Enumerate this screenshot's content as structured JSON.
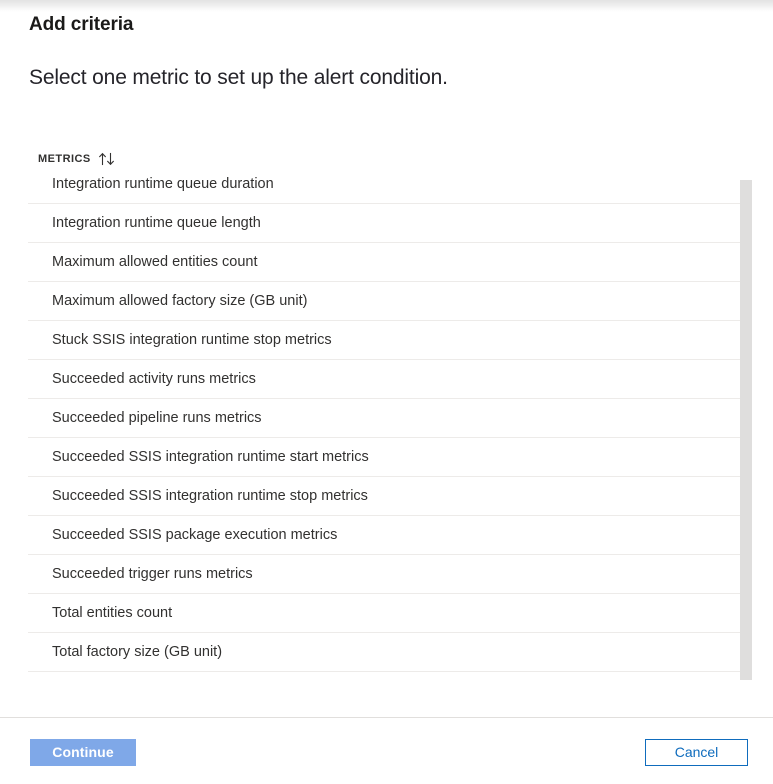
{
  "header": {
    "title": "Add criteria",
    "subtitle": "Select one metric to set up the alert condition."
  },
  "list": {
    "column_header": {
      "label": "METRICS",
      "sort_icon": "sort-up-down-icon"
    },
    "rows": [
      {
        "label": "Integration runtime queue duration"
      },
      {
        "label": "Integration runtime queue length"
      },
      {
        "label": "Maximum allowed entities count"
      },
      {
        "label": "Maximum allowed factory size (GB unit)"
      },
      {
        "label": "Stuck SSIS integration runtime stop metrics"
      },
      {
        "label": "Succeeded activity runs metrics"
      },
      {
        "label": "Succeeded pipeline runs metrics"
      },
      {
        "label": "Succeeded SSIS integration runtime start metrics"
      },
      {
        "label": "Succeeded SSIS integration runtime stop metrics"
      },
      {
        "label": "Succeeded SSIS package execution metrics"
      },
      {
        "label": "Succeeded trigger runs metrics"
      },
      {
        "label": "Total entities count"
      },
      {
        "label": "Total factory size (GB unit)"
      }
    ]
  },
  "footer": {
    "continue_label": "Continue",
    "cancel_label": "Cancel"
  },
  "colors": {
    "primary_button_background": "#7fa8e8",
    "primary_button_text": "#ffffff",
    "secondary_button_border": "#0f6cbd",
    "secondary_button_text": "#0f6cbd",
    "row_separator": "#edebe9",
    "scrollbar_thumb": "#dfdedd",
    "body_text": "#323130"
  }
}
